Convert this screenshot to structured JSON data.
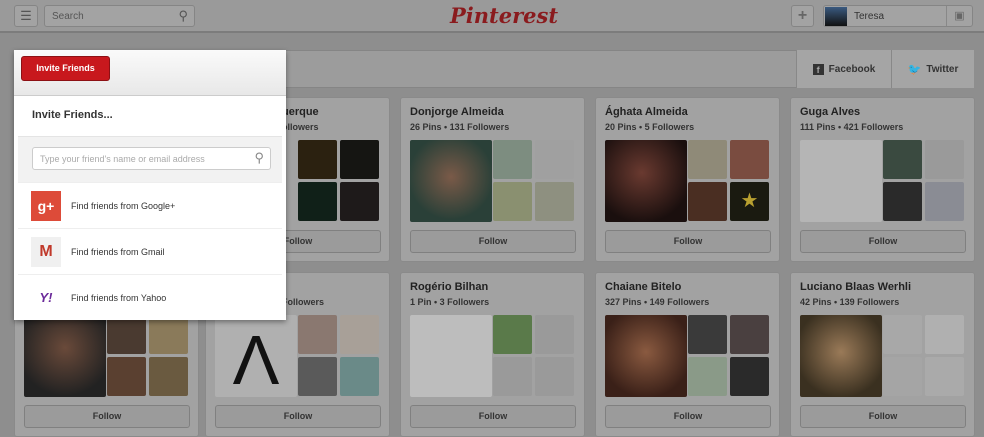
{
  "header": {
    "search_placeholder": "Search",
    "logo": "Pinterest",
    "user_name": "Teresa"
  },
  "share": {
    "facebook": "Facebook",
    "twitter": "Twitter"
  },
  "popup": {
    "button": "Invite Friends",
    "title": "Invite Friends...",
    "input_placeholder": "Type your friend's name or email address",
    "options": [
      {
        "label": "Find friends from Google+"
      },
      {
        "label": "Find friends from Gmail"
      },
      {
        "label": "Find friends from Yahoo"
      }
    ]
  },
  "cards": [
    {
      "name": "uerque",
      "stats": "ollowers",
      "follow": "Follow"
    },
    {
      "name": "Donjorge Almeida",
      "stats": "26 Pins • 131 Followers",
      "follow": "Follow"
    },
    {
      "name": "Ághata Almeida",
      "stats": "20 Pins • 5 Followers",
      "follow": "Follow"
    },
    {
      "name": "Guga Alves",
      "stats": "111 Pins • 421 Followers",
      "follow": "Follow"
    },
    {
      "name": "",
      "stats": "",
      "follow": "Follow"
    },
    {
      "name": "",
      "stats": "Followers",
      "follow": "Follow"
    },
    {
      "name": "Rogério Bilhan",
      "stats": "1 Pin • 3 Followers",
      "follow": "Follow"
    },
    {
      "name": "Chaiane Bitelo",
      "stats": "327 Pins • 149 Followers",
      "follow": "Follow"
    },
    {
      "name": "Luciano Blaas Werhli",
      "stats": "42 Pins • 139 Followers",
      "follow": "Follow"
    }
  ]
}
